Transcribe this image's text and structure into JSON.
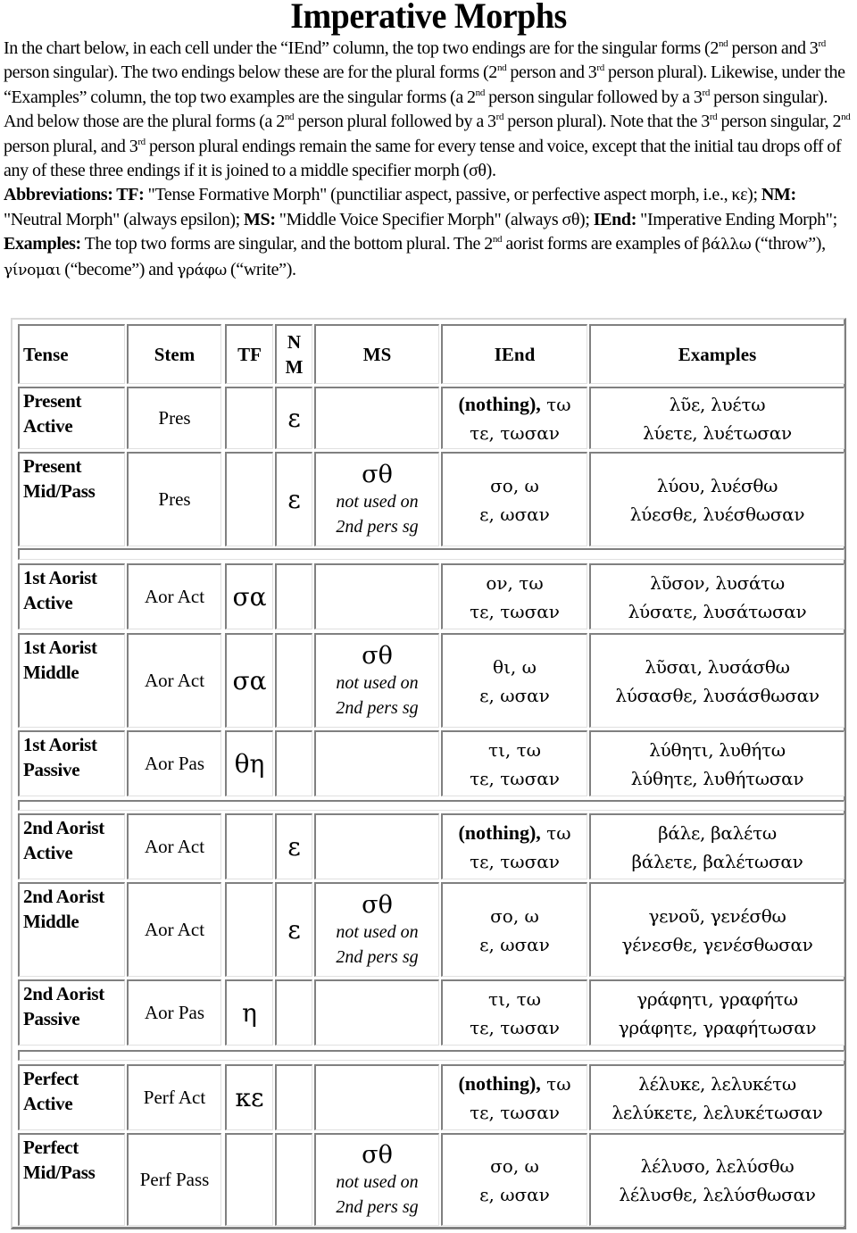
{
  "title": "Imperative Morphs",
  "intro": {
    "p1": [
      {
        "t": "In the chart below, in each cell under the “IEnd” column, the top two endings are for the singular forms (2"
      },
      {
        "sup": "nd"
      },
      {
        "t": " person and 3"
      },
      {
        "sup": "rd"
      },
      {
        "t": " person singular). The two endings below these are for the plural forms (2"
      },
      {
        "sup": "nd"
      },
      {
        "t": " person and 3"
      },
      {
        "sup": "rd"
      },
      {
        "t": " person plural). Likewise, under the “Examples” column, the top two examples are the singular forms (a 2"
      },
      {
        "sup": "nd"
      },
      {
        "t": " person singular followed by a 3"
      },
      {
        "sup": "rd"
      },
      {
        "t": " person singular).  And below those are the plural forms (a 2"
      },
      {
        "sup": "nd"
      },
      {
        "t": " person plural followed by a 3"
      },
      {
        "sup": "rd"
      },
      {
        "t": " person plural). Note that the 3"
      },
      {
        "sup": "rd"
      },
      {
        "t": " person singular, 2"
      },
      {
        "sup": "nd"
      },
      {
        "t": " person plural, and 3"
      },
      {
        "sup": "rd"
      },
      {
        "t": " person plural endings remain the same for every tense and voice, except that the initial tau drops off of any of these three endings if it is joined to a middle specifier morph (σθ)."
      }
    ],
    "p2": [
      {
        "b": "Abbreviations: TF:"
      },
      {
        "t": " \"Tense Formative Morph\" (punctiliar aspect, passive, or perfective aspect morph, i.e., κε); "
      },
      {
        "b": "NM:"
      },
      {
        "t": " \"Neutral Morph\" (always epsilon); "
      },
      {
        "b": "MS:"
      },
      {
        "t": " \"Middle Voice Specifier Morph\" (always σθ); "
      },
      {
        "b": "IEnd:"
      },
      {
        "t": " \"Imperative Ending Morph\"; "
      },
      {
        "b": "Examples:"
      },
      {
        "t": " The top two forms are singular, and the bottom plural. The 2"
      },
      {
        "sup": "nd"
      },
      {
        "t": " aorist forms are examples of  "
      },
      {
        "g": "βάλλω"
      },
      {
        "t": " (“throw”), "
      },
      {
        "g": "γίνομαι"
      },
      {
        "t": " (“become”) and "
      },
      {
        "g": "γράφω"
      },
      {
        "t": " (“write”)."
      }
    ]
  },
  "table": {
    "headers": {
      "tense": "Tense",
      "stem": "Stem",
      "tf": "TF",
      "nm_line1": "N",
      "nm_line2": "M",
      "ms": "MS",
      "iend": "IEnd",
      "examples": "Examples"
    },
    "ms_note_line1": "not used on",
    "ms_note_line2": "2nd pers sg",
    "rows": [
      {
        "tense1": "Present",
        "tense2": "Active",
        "stem": "Pres",
        "tf": "",
        "nm": "ε",
        "ms": "",
        "iend_bold": "(nothing),",
        "iend1": " τω",
        "iend2": "τε, τωσαν",
        "ex1": "λῦε, λυέτω",
        "ex2": "λύετε, λυέτωσαν"
      },
      {
        "tense1": "Present",
        "tense2": "Mid/Pass",
        "stem": "Pres",
        "tf": "",
        "nm": "ε",
        "ms": "σθ",
        "iend_bold": "",
        "iend1": "σο, ω",
        "iend2": "ε, ωσαν",
        "ex1": "λύου, λυέσθω",
        "ex2": "λύεσθε, λυέσθωσαν"
      },
      {
        "tense1": "1st Aorist",
        "tense2": "Active",
        "stem": "Aor Act",
        "tf": "σα",
        "nm": "",
        "ms": "",
        "iend_bold": "",
        "iend1": "ον, τω",
        "iend2": "τε, τωσαν",
        "ex1": "λῦσον, λυσάτω",
        "ex2": "λύσατε, λυσάτωσαν"
      },
      {
        "tense1": "1st Aorist",
        "tense2": "Middle",
        "stem": "Aor Act",
        "tf": "σα",
        "nm": "",
        "ms": "σθ",
        "iend_bold": "",
        "iend1": "θι, ω",
        "iend2": "ε, ωσαν",
        "ex1": "λῦσαι, λυσάσθω",
        "ex2": "λύσασθε, λυσάσθωσαν"
      },
      {
        "tense1": "1st Aorist",
        "tense2": "Passive",
        "stem": "Aor Pas",
        "tf": "θη",
        "nm": "",
        "ms": "",
        "iend_bold": "",
        "iend1": "τι, τω",
        "iend2": "τε, τωσαν",
        "ex1": "λύθητι, λυθήτω",
        "ex2": "λύθητε, λυθήτωσαν"
      },
      {
        "tense1": "2nd Aorist",
        "tense2": "Active",
        "stem": "Aor Act",
        "tf": "",
        "nm": "ε",
        "ms": "",
        "iend_bold": "(nothing),",
        "iend1": " τω",
        "iend2": "τε, τωσαν",
        "ex1": "βάλε, βαλέτω",
        "ex2": "βάλετε, βαλέτωσαν"
      },
      {
        "tense1": "2nd Aorist",
        "tense2": "Middle",
        "stem": "Aor Act",
        "tf": "",
        "nm": "ε",
        "ms": "σθ",
        "iend_bold": "",
        "iend1": "σο, ω",
        "iend2": "ε, ωσαν",
        "ex1": "γενοῦ, γενέσθω",
        "ex2": "γένεσθε, γενέσθωσαν"
      },
      {
        "tense1": "2nd Aorist",
        "tense2": "Passive",
        "stem": "Aor Pas",
        "tf": "η",
        "nm": "",
        "ms": "",
        "iend_bold": "",
        "iend1": "τι, τω",
        "iend2": "τε, τωσαν",
        "ex1": "γράφητι, γραφήτω",
        "ex2": "γράφητε, γραφήτωσαν"
      },
      {
        "tense1": "Perfect",
        "tense2": "Active",
        "stem": "Perf Act",
        "tf": "κε",
        "nm": "",
        "ms": "",
        "iend_bold": "(nothing),",
        "iend1": " τω",
        "iend2": "τε, τωσαν",
        "ex1": "λέλυκε, λελυκέτω",
        "ex2": "λελύκετε, λελυκέτωσαν"
      },
      {
        "tense1": "Perfect",
        "tense2": "Mid/Pass",
        "stem": "Perf Pass",
        "tf": "",
        "nm": "",
        "ms": "σθ",
        "iend_bold": "",
        "iend1": "σο, ω",
        "iend2": "ε, ωσαν",
        "ex1": "λέλυσο, λελύσθω",
        "ex2": "λέλυσθε, λελύσθωσαν"
      }
    ]
  }
}
